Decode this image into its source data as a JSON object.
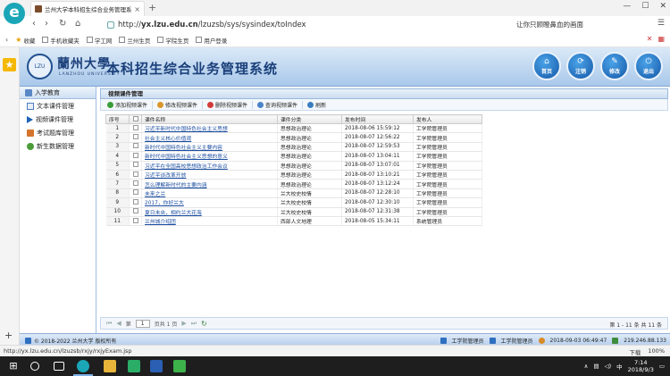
{
  "browser": {
    "tab_title": "兰州大学本科招生综合业务管理系统",
    "tab_close": "×",
    "new_tab": "+",
    "url_prefix": "http://",
    "url_host": "yx.lzu.edu.cn",
    "url_path": "/lzuzsb/sys/sysindex/toIndex",
    "suggestion": "让你只顾瞪鼻血的画面",
    "bookmarks": [
      "收藏",
      "手机收藏夹",
      "学工网",
      "兰州生页",
      "学院生页",
      "用户登录"
    ],
    "status_url": "http://yx.lzu.edu.cn/lzuzsb/rxjy/rxjyExam.jsp",
    "status_right": [
      "下载",
      "100%"
    ]
  },
  "header": {
    "university_name": "蘭州大學",
    "university_en": "LANZHOU UNIVERSITY",
    "system_name": "本科招生综合业务管理系统",
    "buttons": [
      {
        "label": "首页",
        "icon": "home-icon"
      },
      {
        "label": "注销",
        "icon": "logoff-icon"
      },
      {
        "label": "修改",
        "icon": "edit-icon"
      },
      {
        "label": "退出",
        "icon": "power-icon"
      }
    ]
  },
  "menu": {
    "title": "入学教育",
    "items": [
      "文本课件管理",
      "视频课件管理",
      "考试题库管理",
      "新生数据管理"
    ]
  },
  "panel": {
    "title": "视频课件管理",
    "toolbar": [
      "添加视频课件",
      "修改视频课件",
      "删除视频课件",
      "查询视频课件",
      "刷新"
    ]
  },
  "table": {
    "columns": [
      "序号",
      "",
      "课件名称",
      "课件分类",
      "发布时间",
      "发布人"
    ],
    "rows": [
      {
        "no": "1",
        "name": "习近平新时代中国特色社会主义思想",
        "category": "思想政治理论",
        "time": "2018-08-06 15:59:12",
        "publisher": "工学院管理员"
      },
      {
        "no": "2",
        "name": "社会主义核心价值观",
        "category": "思想政治理论",
        "time": "2018-08-07 12:56:22",
        "publisher": "工学院管理员"
      },
      {
        "no": "3",
        "name": "新时代中国特色社会主义主要内容",
        "category": "思想政治理论",
        "time": "2018-08-07 12:59:53",
        "publisher": "工学院管理员"
      },
      {
        "no": "4",
        "name": "新时代中国特色社会主义思想的意义",
        "category": "思想政治理论",
        "time": "2018-08-07 13:04:11",
        "publisher": "工学院管理员"
      },
      {
        "no": "5",
        "name": "习近平在全国高校思想政治工作会议",
        "category": "思想政治理论",
        "time": "2018-08-07 13:07:01",
        "publisher": "工学院管理员"
      },
      {
        "no": "6",
        "name": "习近平谈改革开放",
        "category": "思想政治理论",
        "time": "2018-08-07 13:10:21",
        "publisher": "工学院管理员"
      },
      {
        "no": "7",
        "name": "怎么理解新时代的主要内涵",
        "category": "思想政治理论",
        "time": "2018-08-07 13:12:24",
        "publisher": "工学院管理员"
      },
      {
        "no": "8",
        "name": "未来之兰",
        "category": "兰大校史校情",
        "time": "2018-08-07 12:28:10",
        "publisher": "工学院管理员"
      },
      {
        "no": "9",
        "name": "2017，你好兰大",
        "category": "兰大校史校情",
        "time": "2018-08-07 12:30:10",
        "publisher": "工学院管理员"
      },
      {
        "no": "10",
        "name": "夏日未央，相约兰大花海",
        "category": "兰大校史校情",
        "time": "2018-08-07 12:31:38",
        "publisher": "工学院管理员"
      },
      {
        "no": "11",
        "name": "兰州城介绍团",
        "category": "西部人文地理",
        "time": "2018-08-05 15:34:11",
        "publisher": "系统管理员"
      }
    ]
  },
  "pager": {
    "page_prefix": "第",
    "page_value": "1",
    "page_suffix": "页共 1 页",
    "summary": "第 1 - 11 条 共 11 条"
  },
  "footer": {
    "copyright": "© 2018-2022 兰州大学 版权所有",
    "user1": "工学院管理员",
    "user2": "工学院管理员",
    "datetime": "2018-09-03 06:49:47",
    "ip": "219.246.88.133"
  },
  "taskbar": {
    "time": "7:14",
    "date": "2018/9/3",
    "ime": "中"
  }
}
